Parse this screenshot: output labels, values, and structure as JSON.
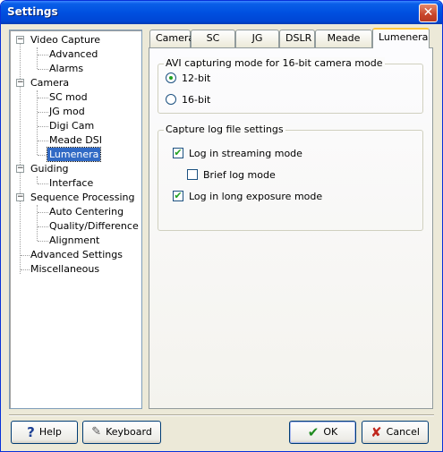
{
  "window": {
    "title": "Settings",
    "close_glyph": "✕"
  },
  "tree": {
    "items": [
      {
        "label": "Video Capture",
        "expander": "−"
      },
      {
        "label": "Advanced"
      },
      {
        "label": "Alarms"
      },
      {
        "label": "Camera",
        "expander": "−"
      },
      {
        "label": "SC mod"
      },
      {
        "label": "JG mod"
      },
      {
        "label": "Digi Cam"
      },
      {
        "label": "Meade DSI"
      },
      {
        "label": "Lumenera",
        "selected": true
      },
      {
        "label": "Guiding",
        "expander": "−"
      },
      {
        "label": "Interface"
      },
      {
        "label": "Sequence Processing",
        "expander": "−"
      },
      {
        "label": "Auto Centering"
      },
      {
        "label": "Quality/Difference"
      },
      {
        "label": "Alignment"
      },
      {
        "label": "Advanced Settings"
      },
      {
        "label": "Miscellaneous"
      }
    ]
  },
  "tabs": [
    "Camera",
    "SC mod",
    "JG mod",
    "DSLR",
    "Meade DSI",
    "Lumenera"
  ],
  "active_tab": "Lumenera",
  "avi_group": {
    "title": "AVI capturing mode for 16-bit camera mode",
    "options": [
      {
        "label": "12-bit",
        "selected": true
      },
      {
        "label": "16-bit",
        "selected": false
      }
    ]
  },
  "log_group": {
    "title": "Capture log file settings",
    "options": [
      {
        "label": "Log in streaming mode",
        "checked": true
      },
      {
        "label": "Brief log mode",
        "checked": false
      },
      {
        "label": "Log in long exposure mode",
        "checked": true
      }
    ],
    "check_glyph": "✔"
  },
  "buttons": {
    "help": "Help",
    "help_icon": "?",
    "keyboard": "Keyboard",
    "keyboard_icon": "✎",
    "ok": "OK",
    "ok_icon": "✔",
    "cancel": "Cancel",
    "cancel_icon": "✘"
  },
  "colors": {
    "title_bar": "#0050e0",
    "selection": "#316ac5",
    "ok_icon": "#1e8a1e",
    "cancel_icon": "#c0281e",
    "help_icon": "#1c3f94"
  }
}
